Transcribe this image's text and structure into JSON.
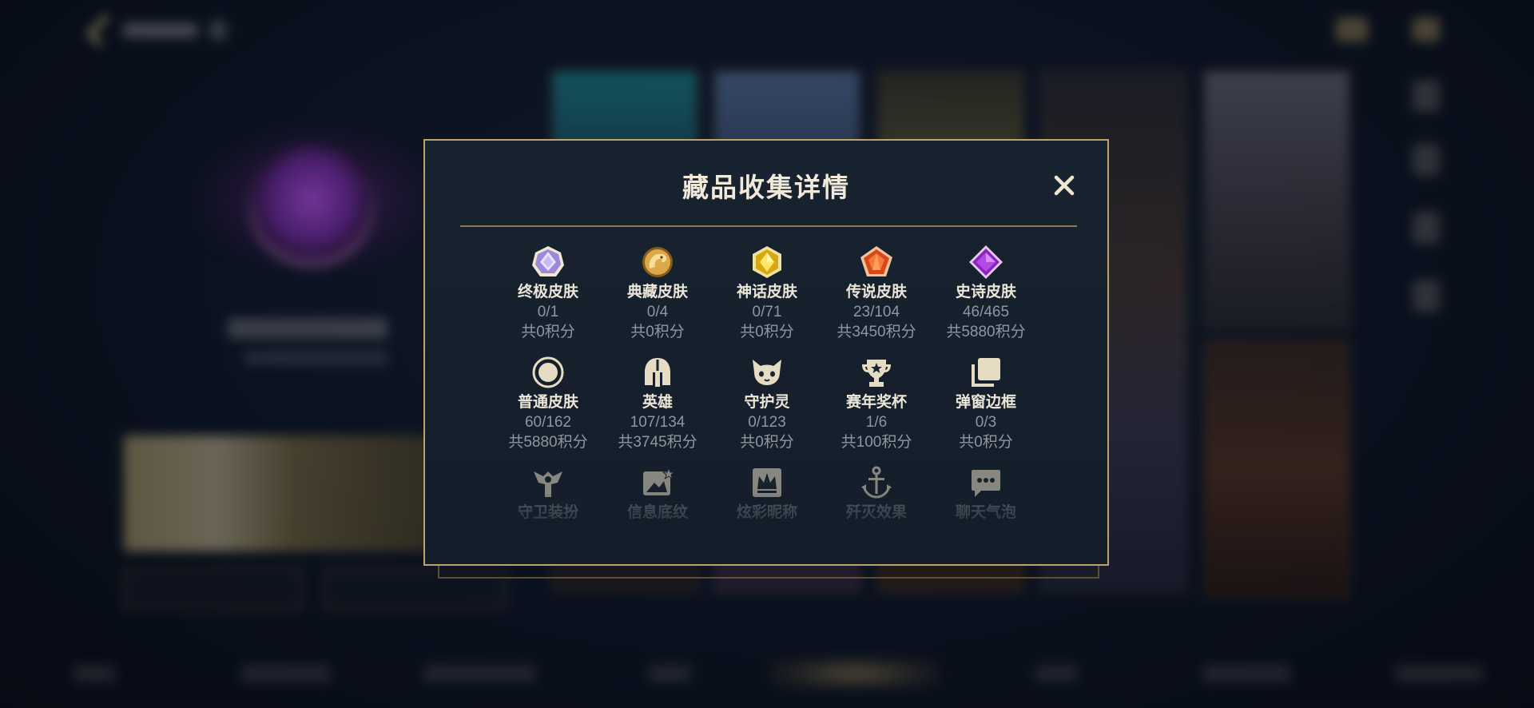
{
  "modal": {
    "title": "藏品收集详情",
    "close_label": "✕"
  },
  "collection": [
    {
      "name": "终极皮肤",
      "count": "0/1",
      "points": "共0积分",
      "icon": "ultimate-skin-gem-icon",
      "color": "#b9a6e8"
    },
    {
      "name": "典藏皮肤",
      "count": "0/4",
      "points": "共0积分",
      "icon": "prestige-skin-dragon-icon",
      "color": "#d9a94a"
    },
    {
      "name": "神话皮肤",
      "count": "0/71",
      "points": "共0积分",
      "icon": "mythic-skin-gem-icon",
      "color": "#e6c02a"
    },
    {
      "name": "传说皮肤",
      "count": "23/104",
      "points": "共3450积分",
      "icon": "legendary-skin-gem-icon",
      "color": "#e8642a"
    },
    {
      "name": "史诗皮肤",
      "count": "46/465",
      "points": "共5880积分",
      "icon": "epic-skin-gem-icon",
      "color": "#a93ad6"
    },
    {
      "name": "普通皮肤",
      "count": "60/162",
      "points": "共5880积分",
      "icon": "standard-skin-circle-icon",
      "color": "#e6dcc4"
    },
    {
      "name": "英雄",
      "count": "107/134",
      "points": "共3745积分",
      "icon": "champion-helmet-icon",
      "color": "#e6dcc4"
    },
    {
      "name": "守护灵",
      "count": "0/123",
      "points": "共0积分",
      "icon": "little-legend-icon",
      "color": "#e6dcc4"
    },
    {
      "name": "赛年奖杯",
      "count": "1/6",
      "points": "共100积分",
      "icon": "season-trophy-icon",
      "color": "#e6dcc4"
    },
    {
      "name": "弹窗边框",
      "count": "0/3",
      "points": "共0积分",
      "icon": "popup-frame-icon",
      "color": "#e6dcc4"
    },
    {
      "name": "守卫装扮",
      "icon": "ward-skin-icon",
      "color": "#e6dcc4"
    },
    {
      "name": "信息底纹",
      "icon": "info-banner-icon",
      "color": "#e6dcc4"
    },
    {
      "name": "炫彩昵称",
      "icon": "chroma-nickname-icon",
      "color": "#e6dcc4"
    },
    {
      "name": "歼灭效果",
      "icon": "annihilation-effect-icon",
      "color": "#e6dcc4"
    },
    {
      "name": "聊天气泡",
      "icon": "chat-bubble-icon",
      "color": "#e6dcc4"
    }
  ],
  "colors": {
    "accent_gold": "#bca36a",
    "modal_bg": "#182330",
    "title_text": "#f1eadb",
    "muted_text": "#8f96a0"
  }
}
